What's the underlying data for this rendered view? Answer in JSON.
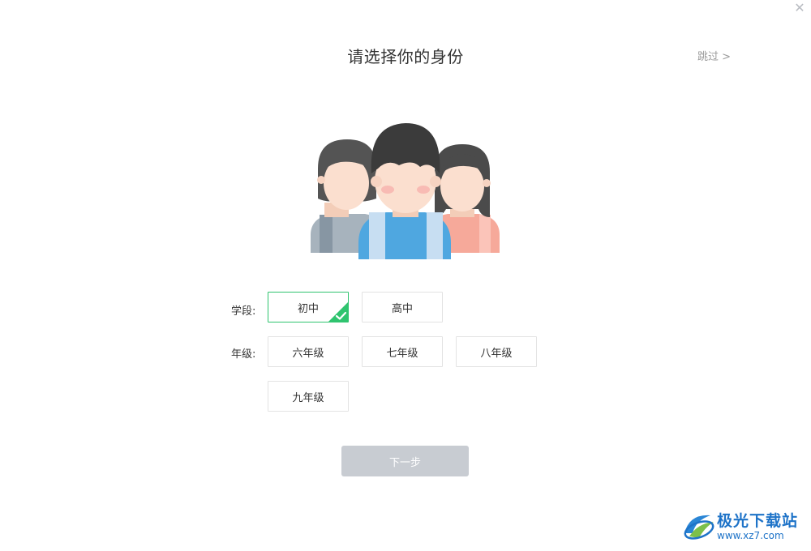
{
  "window": {
    "close_icon": "close-icon"
  },
  "header": {
    "title": "请选择你的身份",
    "skip_label": "跳过 >"
  },
  "illustration": {
    "icon": "students-group-illustration"
  },
  "form": {
    "stage": {
      "label": "学段:",
      "options": [
        {
          "label": "初中",
          "selected": true
        },
        {
          "label": "高中",
          "selected": false
        }
      ]
    },
    "grade": {
      "label": "年级:",
      "options": [
        {
          "label": "六年级"
        },
        {
          "label": "七年级"
        },
        {
          "label": "八年级"
        },
        {
          "label": "九年级"
        }
      ]
    }
  },
  "footer": {
    "next_label": "下一步"
  },
  "watermark": {
    "title": "极光下载站",
    "url": "www.xz7.com"
  },
  "colors": {
    "accent": "#2fc46f",
    "disabled_button": "#c8ccd2",
    "watermark": "#1e73c8"
  }
}
